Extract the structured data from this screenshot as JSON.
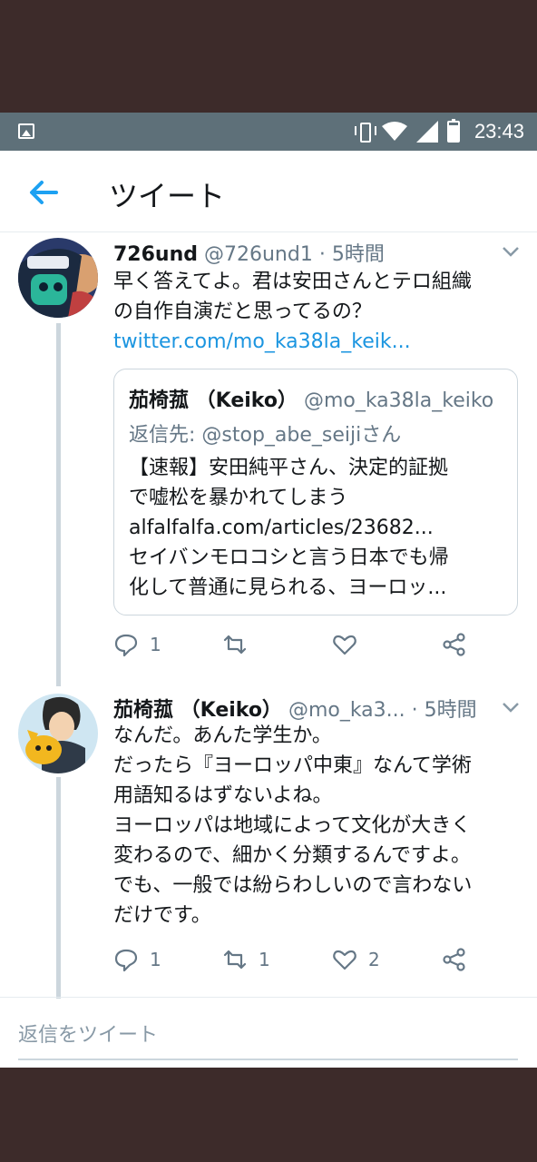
{
  "status_bar": {
    "time": "23:43",
    "icons": [
      "image-icon",
      "vibrate-icon",
      "wifi-icon",
      "signal-icon",
      "battery-icon"
    ]
  },
  "header": {
    "title": "ツイート",
    "back_icon": "arrow-left-icon"
  },
  "tweets": [
    {
      "name": "726und",
      "handle": "@726und1",
      "time": "· 5時間",
      "text_lines": [
        "早く答えてよ。君は安田さんとテロ組織",
        "の自作自演だと思ってるの？"
      ],
      "link": "twitter.com/mo_ka38la_keik...",
      "quote": {
        "name": "茄椅菰 （Keiko）",
        "handle": "@mo_ka38la_keiko",
        "reply_to": "返信先: @stop_abe_seijiさん",
        "text_lines": [
          "【速報】安田純平さん、決定的証拠",
          "で嘘松を暴かれてしまう",
          "alfalfalfa.com/articles/23682...",
          "セイバンモロコシと言う日本でも帰",
          "化して普通に見られる、ヨーロッ..."
        ]
      },
      "actions": {
        "reply": "1",
        "retweet": "",
        "like": "",
        "share": ""
      }
    },
    {
      "name": "茄椅菰 （Keiko）",
      "handle": "@mo_ka3...",
      "time": "· 5時間",
      "text_lines": [
        "なんだ。あんた学生か。",
        "だったら『ヨーロッパ中東』なんて学術",
        "用語知るはずないよね。",
        "ヨーロッパは地域によって文化が大きく",
        "変わるので、細かく分類するんですよ。",
        "でも、一般では紛らわしいので言わない",
        "だけです。"
      ],
      "actions": {
        "reply": "1",
        "retweet": "1",
        "like": "2",
        "share": ""
      }
    }
  ],
  "reply_box": {
    "placeholder": "返信をツイート"
  },
  "colors": {
    "accent": "#1da1f2",
    "link": "#1b95e0",
    "muted": "#657786",
    "status_bar": "#5e7079",
    "background": "#3d2b2a"
  }
}
